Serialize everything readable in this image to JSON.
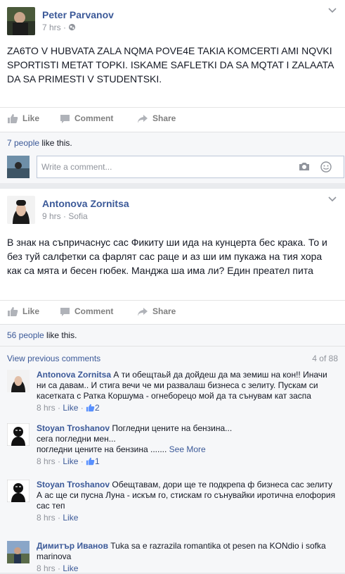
{
  "post1": {
    "author": "Peter Parvanov",
    "time": "7 hrs",
    "text": "ZA6TO V HUBVATA ZALA NQMA POVE4E TAKIA KOMCERTI AMI NQVKI SPORTISTI METAT TOPKI. ISKAME SAFLETKI DA SA MQTAT I ZALAATA DA SA PRIMESTI V STUDENTSKI.",
    "actions": {
      "like": "Like",
      "comment": "Comment",
      "share": "Share"
    },
    "likes_count": "7 people",
    "likes_suffix": " like this.",
    "comment_placeholder": "Write a comment..."
  },
  "post2": {
    "author": "Antonova Zornitsa",
    "time": "9 hrs",
    "location": "Sofia",
    "text": "В знак на съпричаснус сас Фикиту ши ида на кунцерта бес крака. То и без туй салфетки са фарлят сас раце и аз ши им пукажа на тия хора как са мята и бесен гюбек. Манджа ша има ли? Един преател пита",
    "actions": {
      "like": "Like",
      "comment": "Comment",
      "share": "Share"
    },
    "likes_count": "56 people",
    "likes_suffix": " like this.",
    "view_previous": "View previous comments",
    "comment_count": "4 of 88",
    "comments": [
      {
        "name": "Antonova Zornitsa",
        "text": "А ти обещтаьй да дойдеш да ма земиш на кон!! Иначи ни са давам.. И стига вечи че ми развалаш бизнеса с зелиту. Пускам си касетката с Ратка Коршума - огнеборецо мой да та сънувам кат заспа",
        "time": "8 hrs",
        "like": "Like",
        "likes": "2"
      },
      {
        "name": "Stoyan Troshanov",
        "line1": "Погледни цените на бензина...",
        "line2": "сега погледни мен...",
        "line3": "погледни цените на бензина .......",
        "see_more": "See More",
        "time": "8 hrs",
        "like": "Like",
        "likes": "1"
      },
      {
        "name": "Stoyan Troshanov",
        "text": "Обещтавам, дори ще те подкрепа ф бизнеса сас зелиту",
        "text2": "А ас ще си пусна Луна - искъм го, стискам го сънувайки иротична елофория сас теп",
        "time": "8 hrs",
        "like": "Like"
      },
      {
        "name": "Димитър Иванов",
        "text": "Tuka sa e razrazila romantika ot pesen na KONdio i sofka marinova",
        "time": "8 hrs",
        "like": "Like"
      }
    ]
  },
  "colors": {
    "link": "#3b5998",
    "meta": "#90949c",
    "bg": "#e9ebee"
  },
  "icons": [
    "globe-icon",
    "chevron-down-icon",
    "thumbs-up-icon",
    "comment-icon",
    "share-icon",
    "camera-icon",
    "smiley-icon"
  ]
}
